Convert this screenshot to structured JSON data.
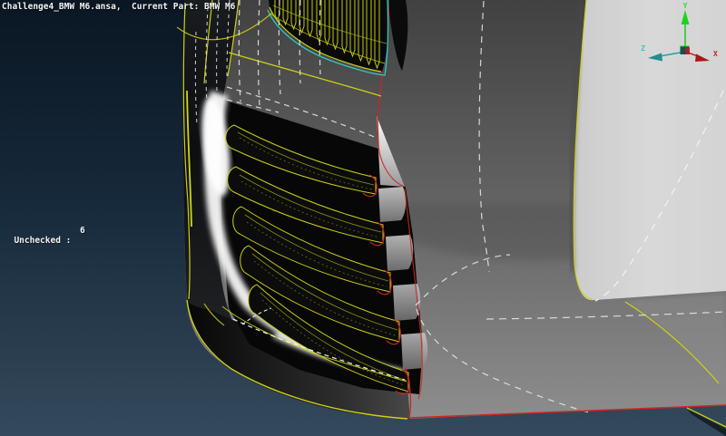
{
  "window": {
    "title": "Challenge4_BMW M6.ansa,  Current Part: BMW M6"
  },
  "status": {
    "label": "Unchecked :",
    "value": "6"
  },
  "axis_triad": {
    "x_label": "X",
    "y_label": "Y",
    "z_label": "Z"
  },
  "colors": {
    "background_top": "#0a1623",
    "background_bottom": "#35495c",
    "wireframe_yellow": "#ccd014",
    "boundary_red": "#cf2424",
    "edge_cyan": "#2fc7c7",
    "dashed_feature_white": "#e6e6e6",
    "hood_gray": "#d6d6d6",
    "bumper_gray": "#6e6e6e",
    "grille_black": "#0a0a0a",
    "axis_x_red": "#d02020",
    "axis_y_green": "#2ae02a",
    "axis_z_teal": "#35c8c8",
    "overlay_text": "#f2f2f2"
  }
}
